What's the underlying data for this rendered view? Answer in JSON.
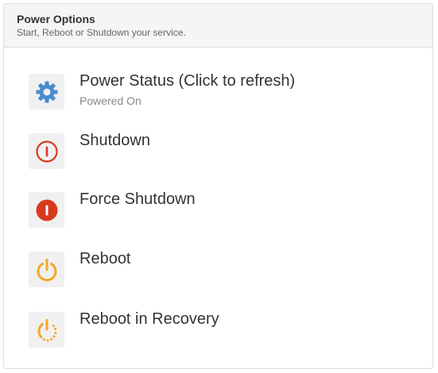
{
  "header": {
    "title": "Power Options",
    "subtitle": "Start, Reboot or Shutdown your service."
  },
  "options": [
    {
      "label": "Power Status (Click to refresh)",
      "status": "Powered On",
      "icon": "gear-icon",
      "color": "#4a8bd0"
    },
    {
      "label": "Shutdown",
      "icon": "shutdown-outline-icon",
      "color": "#d93a1e"
    },
    {
      "label": "Force Shutdown",
      "icon": "force-shutdown-icon",
      "color": "#d93a1e"
    },
    {
      "label": "Reboot",
      "icon": "reboot-icon",
      "color": "#f5a623"
    },
    {
      "label": "Reboot in Recovery",
      "icon": "reboot-recovery-icon",
      "color": "#f5a623"
    }
  ]
}
